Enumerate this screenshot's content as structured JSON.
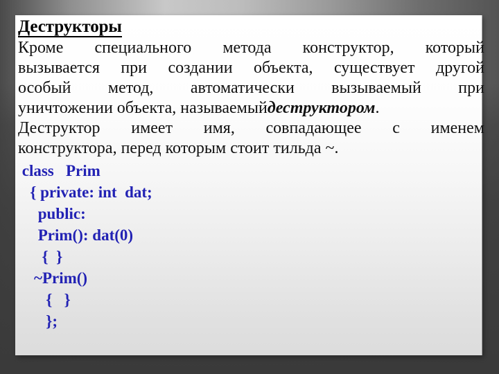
{
  "slide": {
    "title": "Деструкторы",
    "colors": {
      "background_dark": "#4a4a4a",
      "background_light": "#c8c8c8",
      "panel": "#ffffff",
      "panel_bottom": "#dcdcdc",
      "text": "#111111",
      "code": "#2222b4"
    }
  },
  "body": {
    "lines": [
      {
        "id": "line1",
        "align": "justify",
        "text": "Кроме специального метода конструктор, который",
        "words": [
          "Кроме",
          "специального",
          "метода",
          "конструктор,",
          "который"
        ]
      },
      {
        "id": "line2",
        "align": "justify",
        "text": "вызывается при создании объекта, существует другой",
        "words": [
          "вызывается",
          "при",
          "создании",
          "объекта,",
          "существует",
          "другой"
        ]
      },
      {
        "id": "line3",
        "align": "justify",
        "text": "особый метод, автоматически вызываемый при",
        "words": [
          "особый",
          "метод,",
          "автоматически",
          "вызываемый",
          "при"
        ]
      },
      {
        "id": "line4",
        "align": "left",
        "text": "уничтожении объекта, называемый деструктором.",
        "plain_prefix": "уничтожении объекта, называемый ",
        "emphasis": "деструктором",
        "plain_suffix": "."
      },
      {
        "id": "line5",
        "align": "justify",
        "text": "Деструктор имеет имя, совпадающее с именем",
        "words": [
          "Деструктор",
          "имеет",
          "имя,",
          "совпадающее",
          "с",
          "именем"
        ]
      },
      {
        "id": "line6",
        "align": "left",
        "text": "конструктора, перед которым стоит тильда ~."
      }
    ]
  },
  "code": {
    "language": "C++",
    "lines": [
      " class   Prim",
      "   { private: int  dat;",
      "     public:",
      "     Prim(): dat(0)",
      "      {  }",
      "    ~Prim()",
      "       {   }",
      "       };"
    ]
  }
}
